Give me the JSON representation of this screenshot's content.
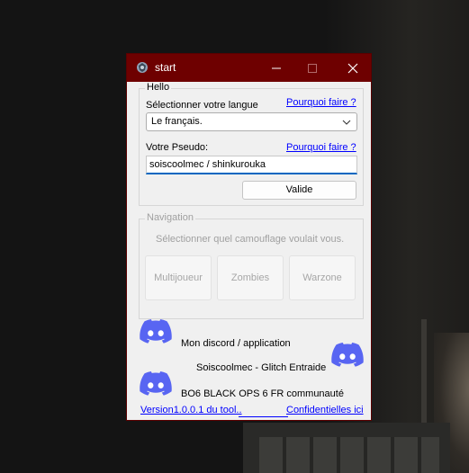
{
  "window": {
    "title": "start"
  },
  "hello_group": {
    "title": "Hello",
    "language_label": "Sélectionner votre langue",
    "language_help_link": "Pourquoi faire ?",
    "language_value": "Le français.",
    "pseudo_label": "Votre Pseudo:",
    "pseudo_help_link": "Pourquoi faire ?",
    "pseudo_value": "soiscoolmec / shinkurouka",
    "validate_button": "Valide"
  },
  "navigation_group": {
    "title": "Navigation",
    "prompt": "Sélectionner quel camouflage voulait vous.",
    "buttons": [
      "Multijoueur",
      "Zombies",
      "Warzone"
    ]
  },
  "footer": {
    "discord_app_text": "Mon discord / application",
    "discord_glitch_text": "Soiscoolmec - Glitch Entraide",
    "discord_bo6_text": "BO6 BLACK OPS 6 FR communauté",
    "version_link": "Version1.0.0.1 du tool..",
    "privacy_link": "Confidentielles ici"
  },
  "colors": {
    "titlebar": "#6e0000",
    "link": "#0000ff",
    "discord_blurple": "#5865f2",
    "focus_underline": "#0067c0"
  },
  "icons": [
    "app-icon",
    "minimize-icon",
    "maximize-icon",
    "close-icon",
    "chevron-down-icon",
    "discord-icon"
  ]
}
